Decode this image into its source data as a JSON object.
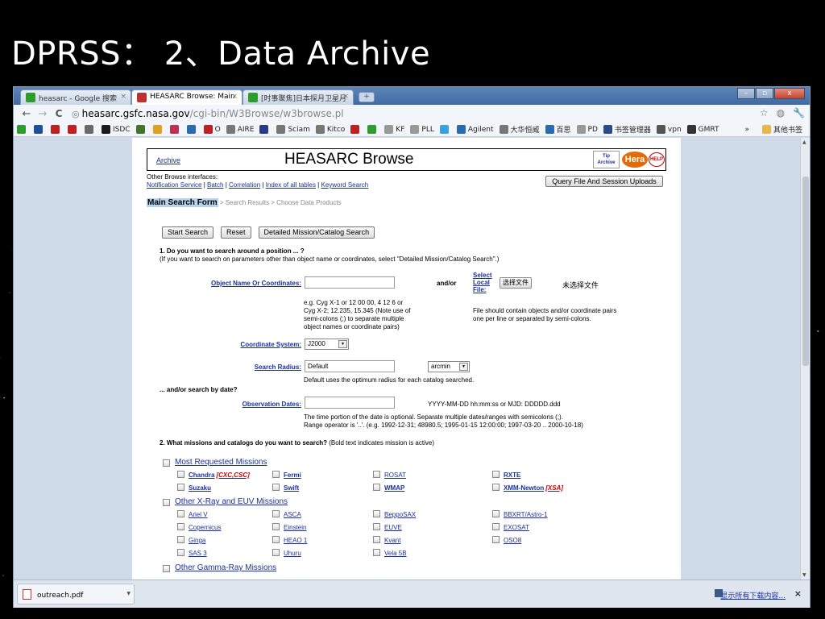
{
  "slide": {
    "title": "DPRSS： 2、Data Archive"
  },
  "browser": {
    "tabs": [
      {
        "label": "heasarc - Google 搜索",
        "close": "×"
      },
      {
        "label": "HEASARC Browse: Main",
        "close": "×"
      },
      {
        "label": "[时事聚焦]日本探月卫星月",
        "close": "×"
      }
    ],
    "new_tab": "+",
    "window_buttons": {
      "minimize": "–",
      "maximize": "▫",
      "close": "x"
    },
    "nav": {
      "back": "←",
      "forward": "→",
      "reload": "C"
    },
    "url": {
      "host": "heasarc.gsfc.nasa.gov",
      "path": "/cgi-bin/W3Browse/w3browse.pl"
    },
    "toolbar_right": {
      "star": "☆",
      "wrench": "🔧"
    },
    "bookmarks": [
      {
        "label": "",
        "color": "#2e9d2e"
      },
      {
        "label": "",
        "color": "#1f4f9a"
      },
      {
        "label": "",
        "color": "#c02020"
      },
      {
        "label": "",
        "color": "#c02020"
      },
      {
        "label": "",
        "color": "#6a6a6a"
      },
      {
        "label": "ISDC",
        "color": "#1a1a1a"
      },
      {
        "label": "",
        "color": "#44742a"
      },
      {
        "label": "",
        "color": "#e0a020"
      },
      {
        "label": "",
        "color": "#c03050"
      },
      {
        "label": "",
        "color": "#2a6ab0"
      },
      {
        "label": "O",
        "color": "#c02020"
      },
      {
        "label": "AIRE",
        "color": "#777"
      },
      {
        "label": "",
        "color": "#2a3a8a"
      },
      {
        "label": "Sciam",
        "color": "#777"
      },
      {
        "label": "Kitco",
        "color": "#777"
      },
      {
        "label": "",
        "color": "#c02020"
      },
      {
        "label": "",
        "color": "#2e9d2e"
      },
      {
        "label": "KF",
        "color": "#999"
      },
      {
        "label": "PLL",
        "color": "#999"
      },
      {
        "label": "",
        "color": "#3aa0e0"
      },
      {
        "label": "Agilent",
        "color": "#2a6ab0"
      },
      {
        "label": "大华恒威",
        "color": "#777"
      },
      {
        "label": "百思",
        "color": "#2a6ab0"
      },
      {
        "label": "PD",
        "color": "#999"
      },
      {
        "label": "书签管理器",
        "color": "#2a4a8a"
      },
      {
        "label": "vpn",
        "color": "#555"
      },
      {
        "label": "GMRT",
        "color": "#333"
      }
    ],
    "bookmarks_more": "»",
    "bookmarks_other": "其他书签"
  },
  "page": {
    "header": {
      "archive": "Archive",
      "title": "HEASARC Browse",
      "tip_line1": "Tip",
      "tip_line2": "Archive",
      "hera": "Hera",
      "help": "HELP"
    },
    "other_interfaces_label": "Other Browse interfaces:",
    "other_links": [
      "Notification Service",
      "Batch",
      "Correlation",
      "Index of all tables",
      "Keyword Search"
    ],
    "query_button": "Query File And Session Uploads",
    "breadcrumb": {
      "current": "Main Search Form",
      "rest": " > Search Results > Choose Data Products"
    },
    "buttons": {
      "start": "Start Search",
      "reset": "Reset",
      "detailed": "Detailed Mission/Catalog Search"
    },
    "q1": {
      "title": "1. Do you want to search around a position ... ?",
      "note": "(If you want to search on parameters other than object name or coordinates, select \"Detailed Mission/Catalog Search\".)"
    },
    "object_name_label": "Object Name Or Coordinates:",
    "object_name_value": "",
    "andor": "and/or",
    "select_local": [
      "Select",
      "Local",
      "File:"
    ],
    "choose_file_button": "选择文件",
    "no_file": "未选择文件",
    "example_lines": [
      "e.g. Cyg X-1 or 12 00 00, 4 12 6 or",
      "Cyg X-2; 12.235, 15.345 (Note use of",
      "semi-colons (;) to separate multiple",
      "object names or coordinate pairs)"
    ],
    "file_note": [
      "File should contain objects and/or coordinate pairs",
      "one per line or separated by semi-colons."
    ],
    "coord_label": "Coordinate System:",
    "coord_value": "J2000",
    "radius_label": "Search Radius:",
    "radius_value": "Default",
    "radius_unit": "arcmin",
    "radius_note": "Default uses the optimum radius for each catalog searched.",
    "date_question": "... and/or search by date?",
    "obs_label": "Observation Dates:",
    "obs_value": "",
    "obs_format": "YYYY-MM-DD hh:mm:ss or MJD: DDDDD.ddd",
    "obs_note": [
      "The time portion of the date is optional. Separate multiple dates/ranges with semicolons (;).",
      "Range operator is '..'. (e.g. 1992-12-31; 48980.5; 1995-01-15 12:00:00; 1997-03-20 .. 2000-10-18)"
    ],
    "q2": {
      "title": "2. What missions and catalogs do you want to search?",
      "note": " (Bold text indicates mission is active)"
    },
    "groups": [
      {
        "label": "Most Requested Missions",
        "missions": [
          {
            "name": "Chandra",
            "bold": true,
            "extra": "[CXC,CSC]"
          },
          {
            "name": "Fermi",
            "bold": true,
            "extra": ""
          },
          {
            "name": "ROSAT",
            "bold": false,
            "extra": ""
          },
          {
            "name": "RXTE",
            "bold": true,
            "extra": ""
          },
          {
            "name": "Suzaku",
            "bold": true,
            "extra": ""
          },
          {
            "name": "Swift",
            "bold": true,
            "extra": ""
          },
          {
            "name": "WMAP",
            "bold": true,
            "extra": ""
          },
          {
            "name": "XMM-Newton",
            "bold": true,
            "extra": "[XSA]"
          }
        ]
      },
      {
        "label": "Other X-Ray and EUV Missions",
        "missions": [
          {
            "name": "Ariel V",
            "bold": false,
            "extra": ""
          },
          {
            "name": "ASCA",
            "bold": false,
            "extra": ""
          },
          {
            "name": "BeppoSAX",
            "bold": false,
            "extra": ""
          },
          {
            "name": "BBXRT/Astro-1",
            "bold": false,
            "extra": ""
          },
          {
            "name": "Copernicus",
            "bold": false,
            "extra": ""
          },
          {
            "name": "Einstein",
            "bold": false,
            "extra": ""
          },
          {
            "name": "EUVE",
            "bold": false,
            "extra": ""
          },
          {
            "name": "EXOSAT",
            "bold": false,
            "extra": ""
          },
          {
            "name": "Ginga",
            "bold": false,
            "extra": ""
          },
          {
            "name": "HEAO 1",
            "bold": false,
            "extra": ""
          },
          {
            "name": "Kvant",
            "bold": false,
            "extra": ""
          },
          {
            "name": "OSO8",
            "bold": false,
            "extra": ""
          },
          {
            "name": "SAS 3",
            "bold": false,
            "extra": ""
          },
          {
            "name": "Uhuru",
            "bold": false,
            "extra": ""
          },
          {
            "name": "Vela 5B",
            "bold": false,
            "extra": ""
          }
        ]
      },
      {
        "label": "Other Gamma-Ray Missions",
        "missions": []
      }
    ]
  },
  "download_bar": {
    "file": "outreach.pdf",
    "show_all": "显示所有下载内容...",
    "close": "×"
  }
}
